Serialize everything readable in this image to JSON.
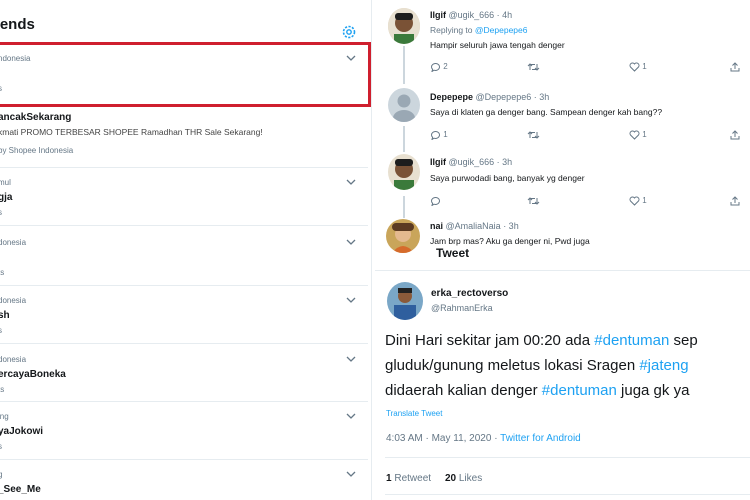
{
  "trends": {
    "title": "rends",
    "items": [
      {
        "context": "ndonesia",
        "name": "",
        "count": "s",
        "desc": ""
      },
      {
        "context": "",
        "name": "ancakSekarang",
        "count": "by Shopee Indonesia",
        "desc": "kmati PROMO TERBESAR SHOPEE Ramadhan THR Sale Sekarang!"
      },
      {
        "context": "mul",
        "name": "gja",
        "count": "s",
        "desc": ""
      },
      {
        "context": "donesia",
        "name": "",
        "count": "ts",
        "desc": ""
      },
      {
        "context": "donesia",
        "name": "sh",
        "count": "s",
        "desc": ""
      },
      {
        "context": "donesia",
        "name": "ercayaBoneka",
        "count": "ts",
        "desc": ""
      },
      {
        "context": "ing",
        "name": "yaJokowi",
        "count": "s",
        "desc": ""
      },
      {
        "context": "g",
        "name": "_See_Me",
        "count": "s",
        "desc": ""
      }
    ]
  },
  "replies": [
    {
      "name": "Ilgif",
      "handle": "@ugik_666 · 4h",
      "replying_label": "Replying to",
      "replying_to": "@Depepepe6",
      "text": "Hampir seluruh jawa tengah denger",
      "counts": {
        "reply": "2",
        "retweet": "",
        "like": "1"
      }
    },
    {
      "name": "Depepepe",
      "handle": "@Depepepe6 · 3h",
      "text": "Saya di klaten ga denger bang. Sampean denger kah bang??",
      "counts": {
        "reply": "1",
        "retweet": "",
        "like": "1"
      }
    },
    {
      "name": "Ilgif",
      "handle": "@ugik_666 · 3h",
      "text": "Saya purwodadi bang, banyak yg denger",
      "counts": {
        "reply": "",
        "retweet": "",
        "like": "1"
      }
    },
    {
      "name": "nai",
      "handle": "@AmaliaNaia · 3h",
      "text": "Jam brp mas? Aku ga denger ni, Pwd juga"
    }
  ],
  "main_tweet": {
    "tag": "Tweet",
    "name": "erka_rectoverso",
    "handle": "@RahmanErka",
    "line1_a": "Dini Hari sekitar jam 00:20 ada ",
    "line1_tag": "#dentuman",
    "line1_b": " sep",
    "line2_a": "gluduk/gunung meletus lokasi Sragen ",
    "line2_tag": "#jateng",
    "line3_a": "didaerah kalian denger ",
    "line3_tag": "#dentuman",
    "line3_b": " juga gk ya",
    "translate": "Translate Tweet",
    "time": "4:03 AM · May 11, 2020 · ",
    "app": "Twitter for Android",
    "retweets": "1",
    "retweets_label": "Retweet",
    "likes": "20",
    "likes_label": "Likes"
  },
  "colors": {
    "accent": "#1da1f2",
    "highlight": "#cf1f2e"
  }
}
